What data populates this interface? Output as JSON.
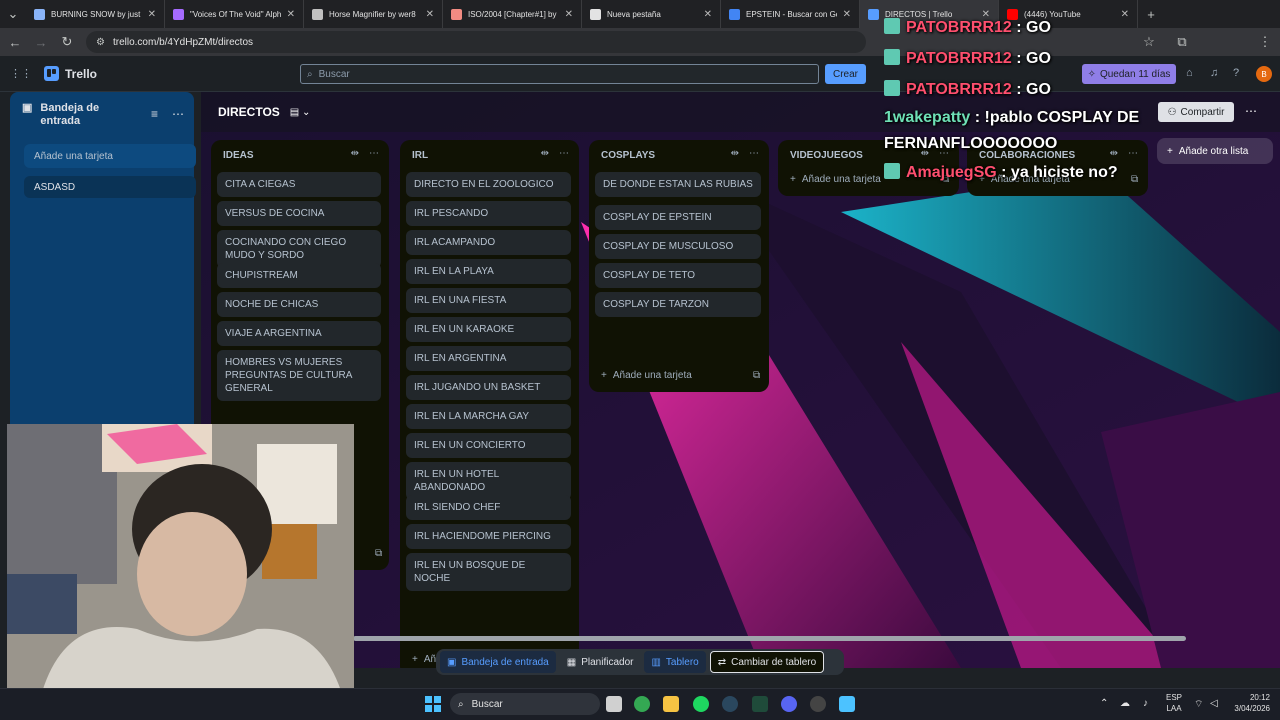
{
  "browser": {
    "tabs": [
      {
        "title": "BURNING SNOW by just",
        "color": "#8ab4f8"
      },
      {
        "title": "\"Voices Of The Void\" Alph",
        "color": "#a66bff"
      },
      {
        "title": "Horse Magnifier by wer8",
        "color": "#c0c0c0"
      },
      {
        "title": "ISO/2004 [Chapter#1] by",
        "color": "#f28b82"
      },
      {
        "title": "Nueva pestaña",
        "color": "#e3e3e3"
      },
      {
        "title": "EPSTEIN - Buscar con Goo",
        "color": "#4285f4"
      },
      {
        "title": "DIRECTOS | Trello",
        "color": "#579dff"
      },
      {
        "title": "(4446) YouTube",
        "color": "#ff0000"
      }
    ],
    "url": "trello.com/b/4YdHpZMt/directos"
  },
  "trello": {
    "app_name": "Trello",
    "search_placeholder": "Buscar",
    "create_label": "Crear",
    "trial_label": "Quedan 11 días",
    "avatar_initial": "B"
  },
  "inbox": {
    "title": "Bandeja de entrada",
    "add_card": "Añade una tarjeta",
    "cards": [
      "ASDASD"
    ]
  },
  "board": {
    "title": "DIRECTOS",
    "share_label": "Compartir",
    "add_list_label": "Añade otra lista",
    "add_card_label": "Añade una tarjeta",
    "lists": [
      {
        "title": "IDEAS",
        "cards": [
          "CITA A CIEGAS",
          "VERSUS DE COCINA",
          "COCINANDO CON CIEGO MUDO Y SORDO",
          "CHUPISTREAM",
          "NOCHE DE CHICAS",
          "VIAJE A ARGENTINA",
          "HOMBRES VS MUJERES PREGUNTAS DE CULTURA GENERAL"
        ]
      },
      {
        "title": "IRL",
        "cards": [
          "DIRECTO EN EL ZOOLOGICO",
          "IRL PESCANDO",
          "IRL ACAMPANDO",
          "IRL EN LA PLAYA",
          "IRL EN UNA FIESTA",
          "IRL EN UN KARAOKE",
          "IRL EN ARGENTINA",
          "IRL JUGANDO UN BASKET",
          "IRL EN LA MARCHA GAY",
          "IRL EN UN CONCIERTO",
          "IRL EN UN HOTEL ABANDONADO",
          "IRL SIENDO CHEF",
          "IRL HACIENDOME PIERCING",
          "IRL EN UN BOSQUE DE NOCHE"
        ]
      },
      {
        "title": "COSPLAYS",
        "cards": [
          "DE DONDE ESTAN LAS RUBIAS",
          "COSPLAY DE EPSTEIN",
          "COSPLAY DE MUSCULOSO",
          "COSPLAY DE TETO",
          "COSPLAY DE TARZON"
        ]
      },
      {
        "title": "VIDEOJUEGOS",
        "cards": []
      },
      {
        "title": "COLABORACIONES",
        "cards": []
      }
    ]
  },
  "bottom_nav": {
    "inbox": "Bandeja de entrada",
    "planner": "Planificador",
    "board": "Tablero",
    "switch": "Cambiar de tablero"
  },
  "taskbar": {
    "search": "Buscar",
    "lang1": "ESP",
    "lang2": "LAA",
    "time": "20:12",
    "date": "3/04/2026"
  },
  "chat": [
    {
      "user": "PATOBRRR12",
      "msg": ": GO",
      "style": "u1",
      "badge": true
    },
    {
      "user": "PATOBRRR12",
      "msg": ": GO",
      "style": "u1",
      "badge": true
    },
    {
      "user": "PATOBRRR12",
      "msg": ": GO",
      "style": "u1",
      "badge": true
    },
    {
      "user": "1wakepatty",
      "msg": ": !pablo COSPLAY DE FERNANFLOOOOOOO",
      "style": "u2",
      "badge": false
    },
    {
      "user": "AmajuegSG",
      "msg": ": ya hiciste no?",
      "style": "u1",
      "badge": true
    }
  ]
}
